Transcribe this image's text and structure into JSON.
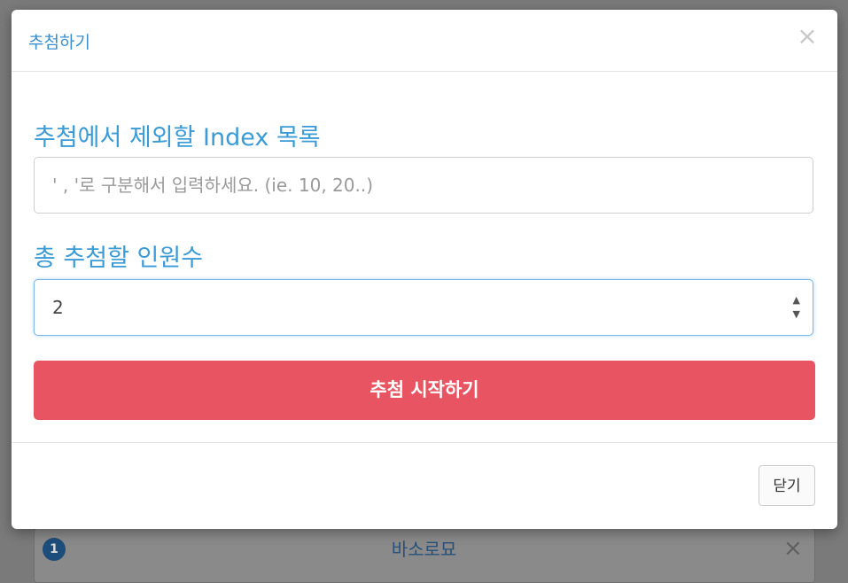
{
  "modal": {
    "title": "추첨하기",
    "close_icon": "×",
    "exclude_label": "추첨에서 제외할 Index 목록",
    "exclude_placeholder": "' , '로 구분해서 입력하세요. (ie. 10, 20..)",
    "total_label": "총 추첨할 인원수",
    "total_value": "2",
    "spinner_up": "▲",
    "spinner_down": "▼",
    "start_button": "추첨 시작하기",
    "footer_close_button": "닫기"
  },
  "background": {
    "badge": "1",
    "title": "바소로묘",
    "close_icon": "×"
  },
  "colors": {
    "accent": "#3a9bd6",
    "danger": "#e85461"
  }
}
